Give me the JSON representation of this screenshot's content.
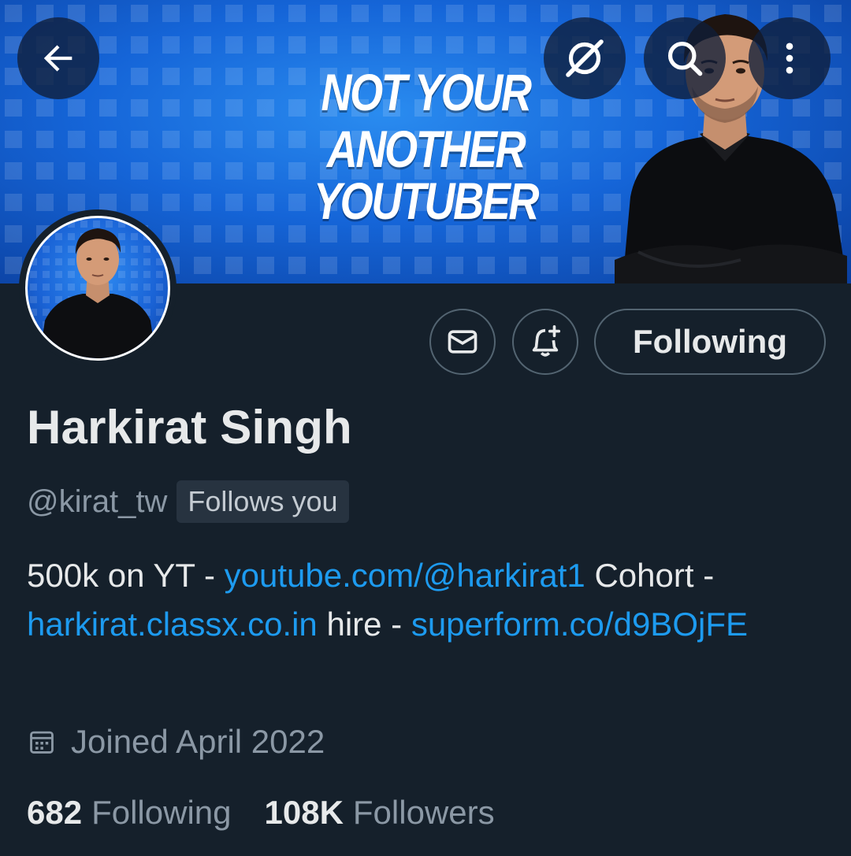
{
  "banner": {
    "headline_line1": "NOT YOUR",
    "headline_line2": "ANOTHER YOUTUBER"
  },
  "header_buttons": {
    "back": "arrow-left-icon",
    "grok": "grok-icon",
    "search": "search-icon",
    "more": "more-vertical-icon"
  },
  "profile": {
    "name": "Harkirat Singh",
    "handle": "@kirat_tw",
    "follows_you": "Follows you",
    "following_button": "Following",
    "bio": {
      "part1": "500k on YT - ",
      "link1": "youtube.com/@harkirat1",
      "part2": " Cohort - ",
      "link2": "harkirat.classx.co.in",
      "part3": " hire - ",
      "link3": "superform.co/d9BOjFE"
    },
    "joined": "Joined April 2022",
    "following_count": "682",
    "following_label": "Following",
    "followers_count": "108K",
    "followers_label": "Followers"
  },
  "colors": {
    "background": "#15202b",
    "link": "#1d9bf0",
    "muted": "#8b98a5",
    "text": "#e7e9ea",
    "border": "#536471"
  }
}
